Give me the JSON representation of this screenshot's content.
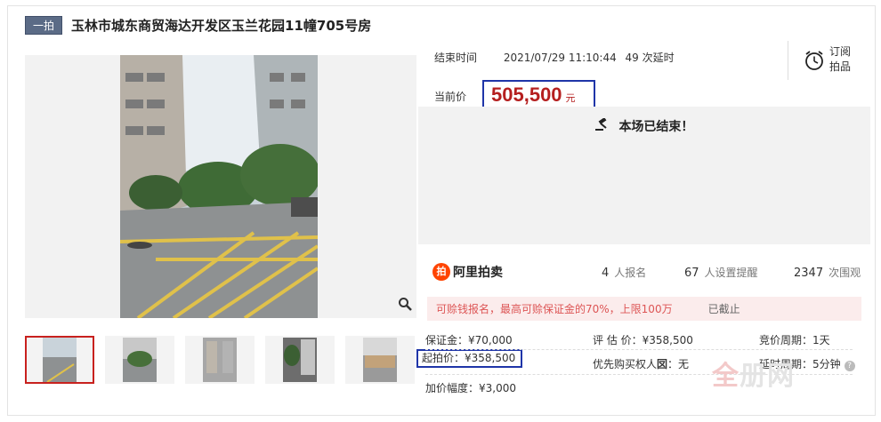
{
  "header": {
    "badge": "一拍",
    "title": "玉林市城东商贸海达开发区玉兰花园11幢705号房"
  },
  "auction": {
    "end_label": "结束时间",
    "end_time": "2021/07/29 11:10:44",
    "delays": "49 次延时",
    "price_label": "当前价",
    "price": "505,500",
    "price_unit": "元",
    "status": "本场已结束！"
  },
  "subscribe": {
    "line1": "订阅",
    "line2": "拍品"
  },
  "brand": {
    "logo_mark": "拍",
    "name": "阿里拍卖"
  },
  "stats": [
    {
      "num": "4",
      "label": "人报名"
    },
    {
      "num": "67",
      "label": "人设置提醒"
    },
    {
      "num": "2347",
      "label": "次围观"
    }
  ],
  "notice": {
    "text": "可赊钱报名，最高可赊保证金的70%，上限100万",
    "status": "已截止"
  },
  "details": {
    "deposit": "保证金：¥70,000",
    "start_price": "起拍价：¥358,500",
    "increment": "加价幅度：¥3,000",
    "valuation": "评 估 价：¥358,500",
    "priority_prefix": "优先购买权人",
    "priority_mark": "㘝",
    "priority_value": "：无",
    "cycle": "竞价周期：1天",
    "delay_cycle": "延时周期：5分钟"
  },
  "watermark": {
    "brand_a": "全",
    "brand_b": "册网"
  },
  "colors": {
    "price": "#b51f1f",
    "highlight_box": "#1f35a8",
    "brand": "#ff4400",
    "badge": "#5b6b86"
  }
}
